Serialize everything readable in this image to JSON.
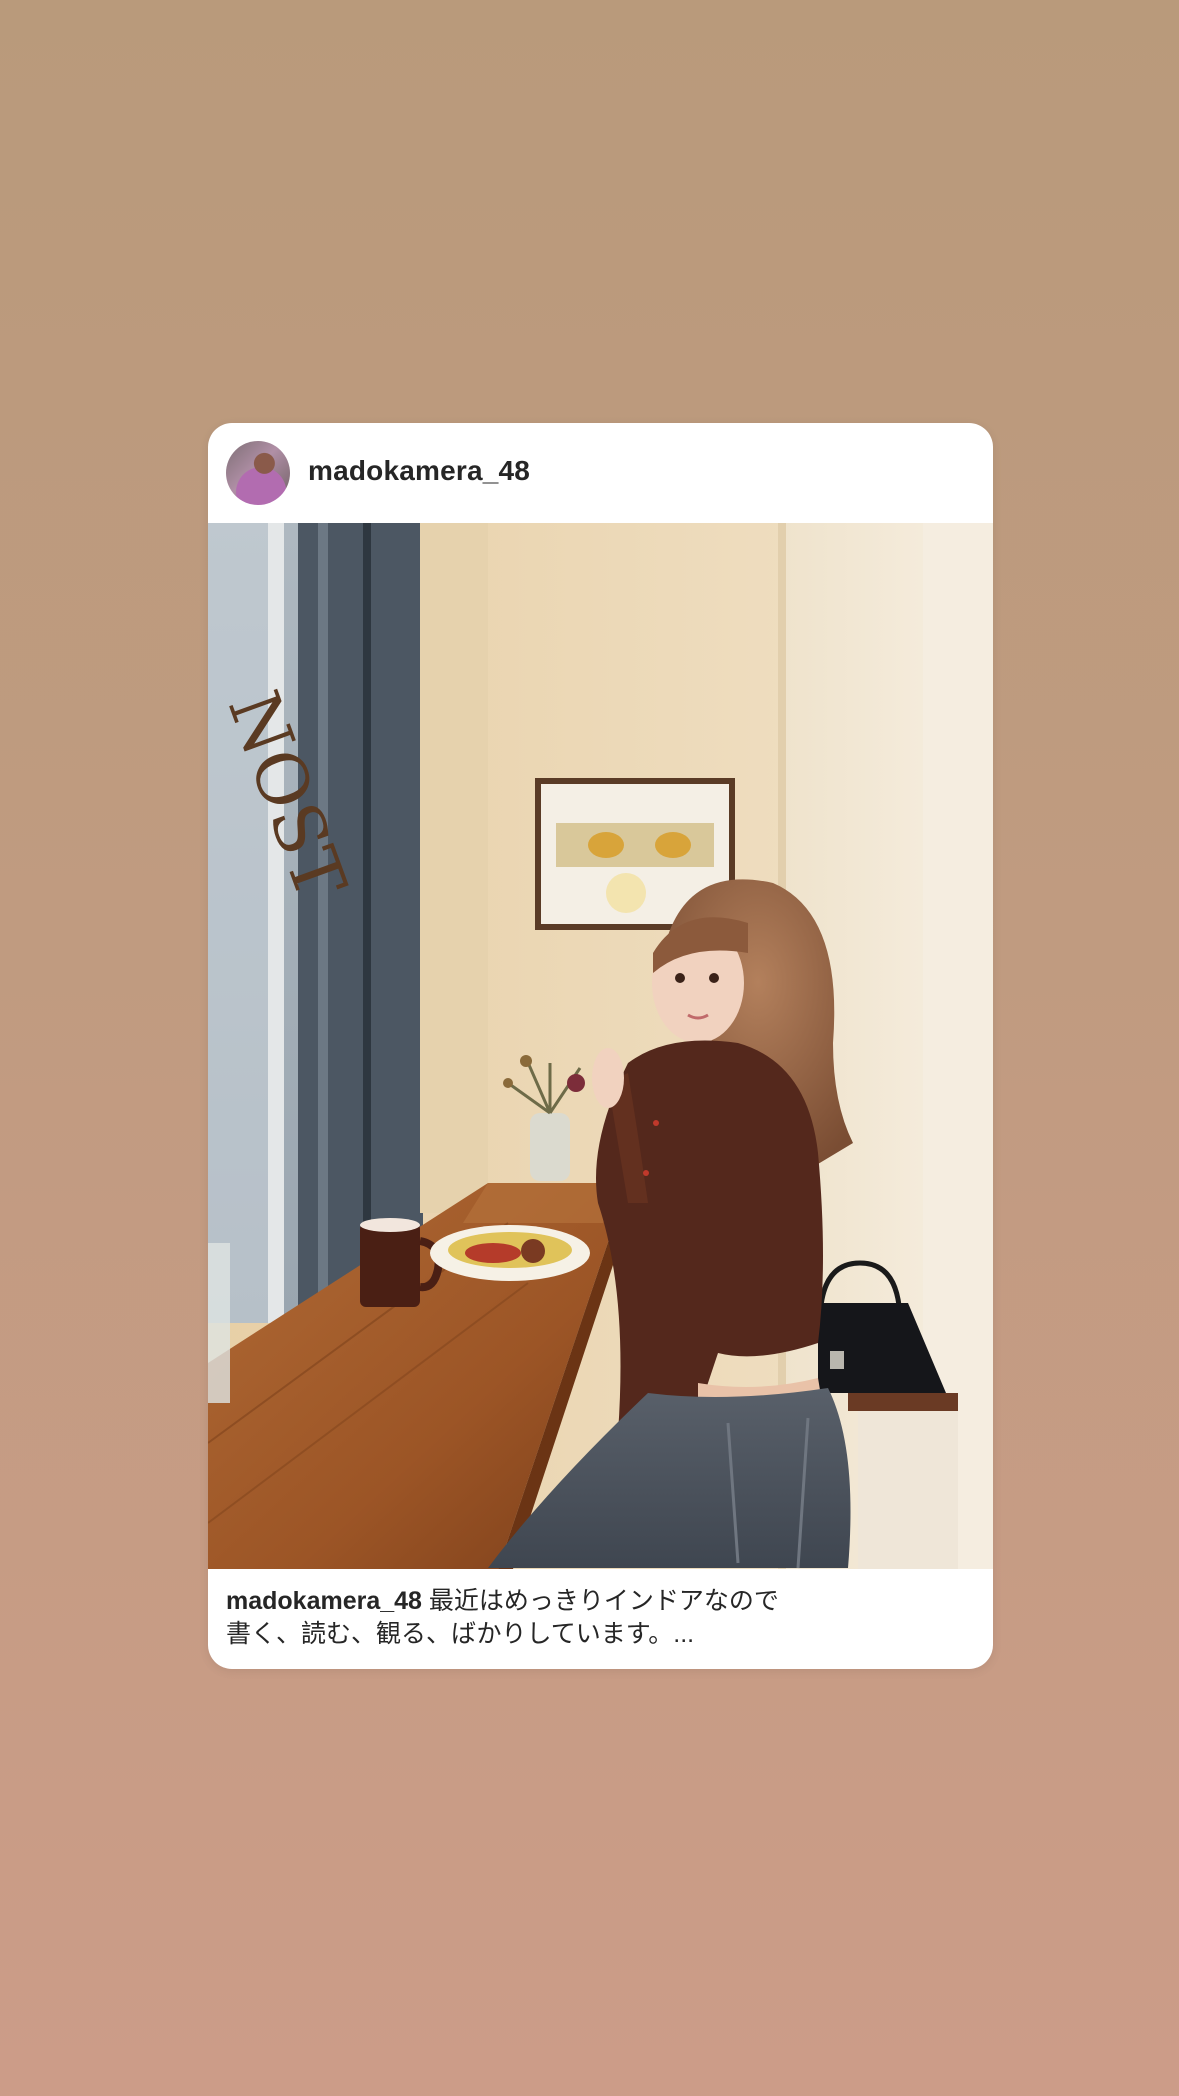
{
  "post": {
    "username": "madokamera_48",
    "caption_username": "madokamera_48",
    "caption_line1": "最近はめっきりインドアなので",
    "caption_line2": "書く、読む、観る、ばかりしています。..."
  },
  "photo": {
    "window_lettering": "NOST",
    "icon": "photo-image"
  },
  "colors": {
    "background_top": "#b99a7b",
    "background_bottom": "#cc9c88",
    "card": "#ffffff",
    "text": "#262626"
  }
}
